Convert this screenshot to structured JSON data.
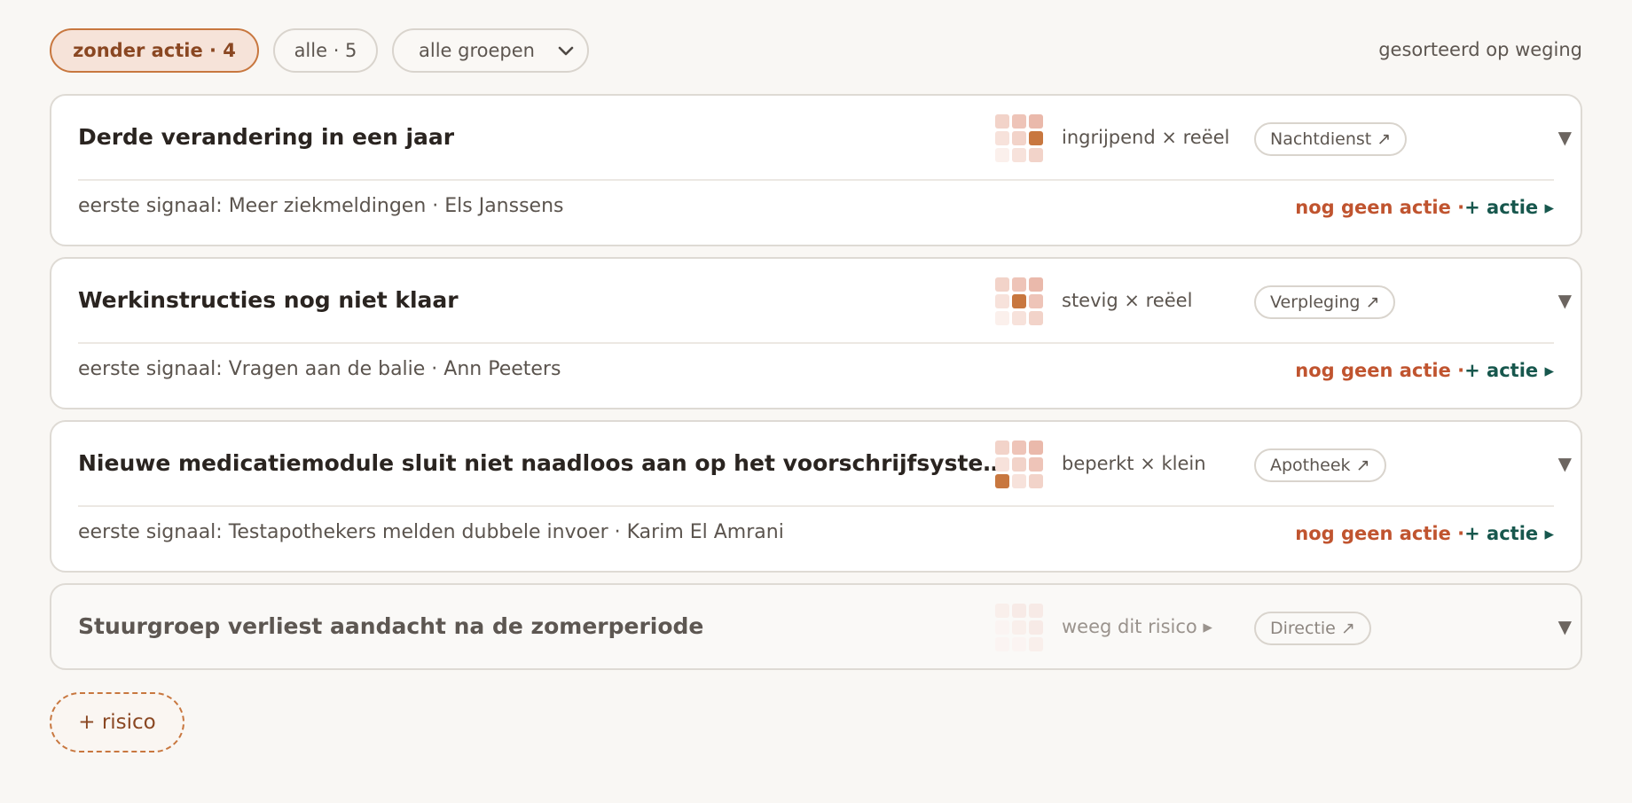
{
  "filters": {
    "without_action": "zonder actie · 4",
    "all": "alle · 5",
    "group_select": "alle groepen",
    "sort_label": "gesorteerd op weging"
  },
  "risks": [
    {
      "title": "Derde verandering in een jaar",
      "weight": "ingrijpend × reëel",
      "group": "Nachtdienst ↗",
      "signal": "eerste signaal: Meer ziekmeldingen · Els Janssens",
      "status": "nog geen actie ·",
      "action": "+ actie ▸",
      "impact_level": 3,
      "likelihood_level": 2,
      "toggle": "▼"
    },
    {
      "title": "Werkinstructies nog niet klaar",
      "weight": "stevig × reëel",
      "group": "Verpleging ↗",
      "signal": "eerste signaal: Vragen aan de balie · Ann Peeters",
      "status": "nog geen actie ·",
      "action": "+ actie ▸",
      "impact_level": 2,
      "likelihood_level": 2,
      "toggle": "▼"
    },
    {
      "title": "Nieuwe medicatiemodule sluit niet naadloos aan op het voorschrijfsysteem",
      "weight": "beperkt × klein",
      "group": "Apotheek ↗",
      "signal": "eerste signaal: Testapothekers melden dubbele invoer · Karim El Amrani",
      "status": "nog geen actie ·",
      "action": "+ actie ▸",
      "impact_level": 1,
      "likelihood_level": 1,
      "toggle": "▼"
    },
    {
      "title": "Stuurgroep verliest aandacht na de zomerperiode",
      "weight": "weeg dit risico ▸",
      "group": "Directie ↗",
      "toggle": "▼"
    }
  ],
  "add_risk": "+ risico",
  "colors": {
    "accent": "#c8773f",
    "no_action": "#c0542f",
    "add_action": "#17574d",
    "grid_selected": "#c8773f"
  }
}
